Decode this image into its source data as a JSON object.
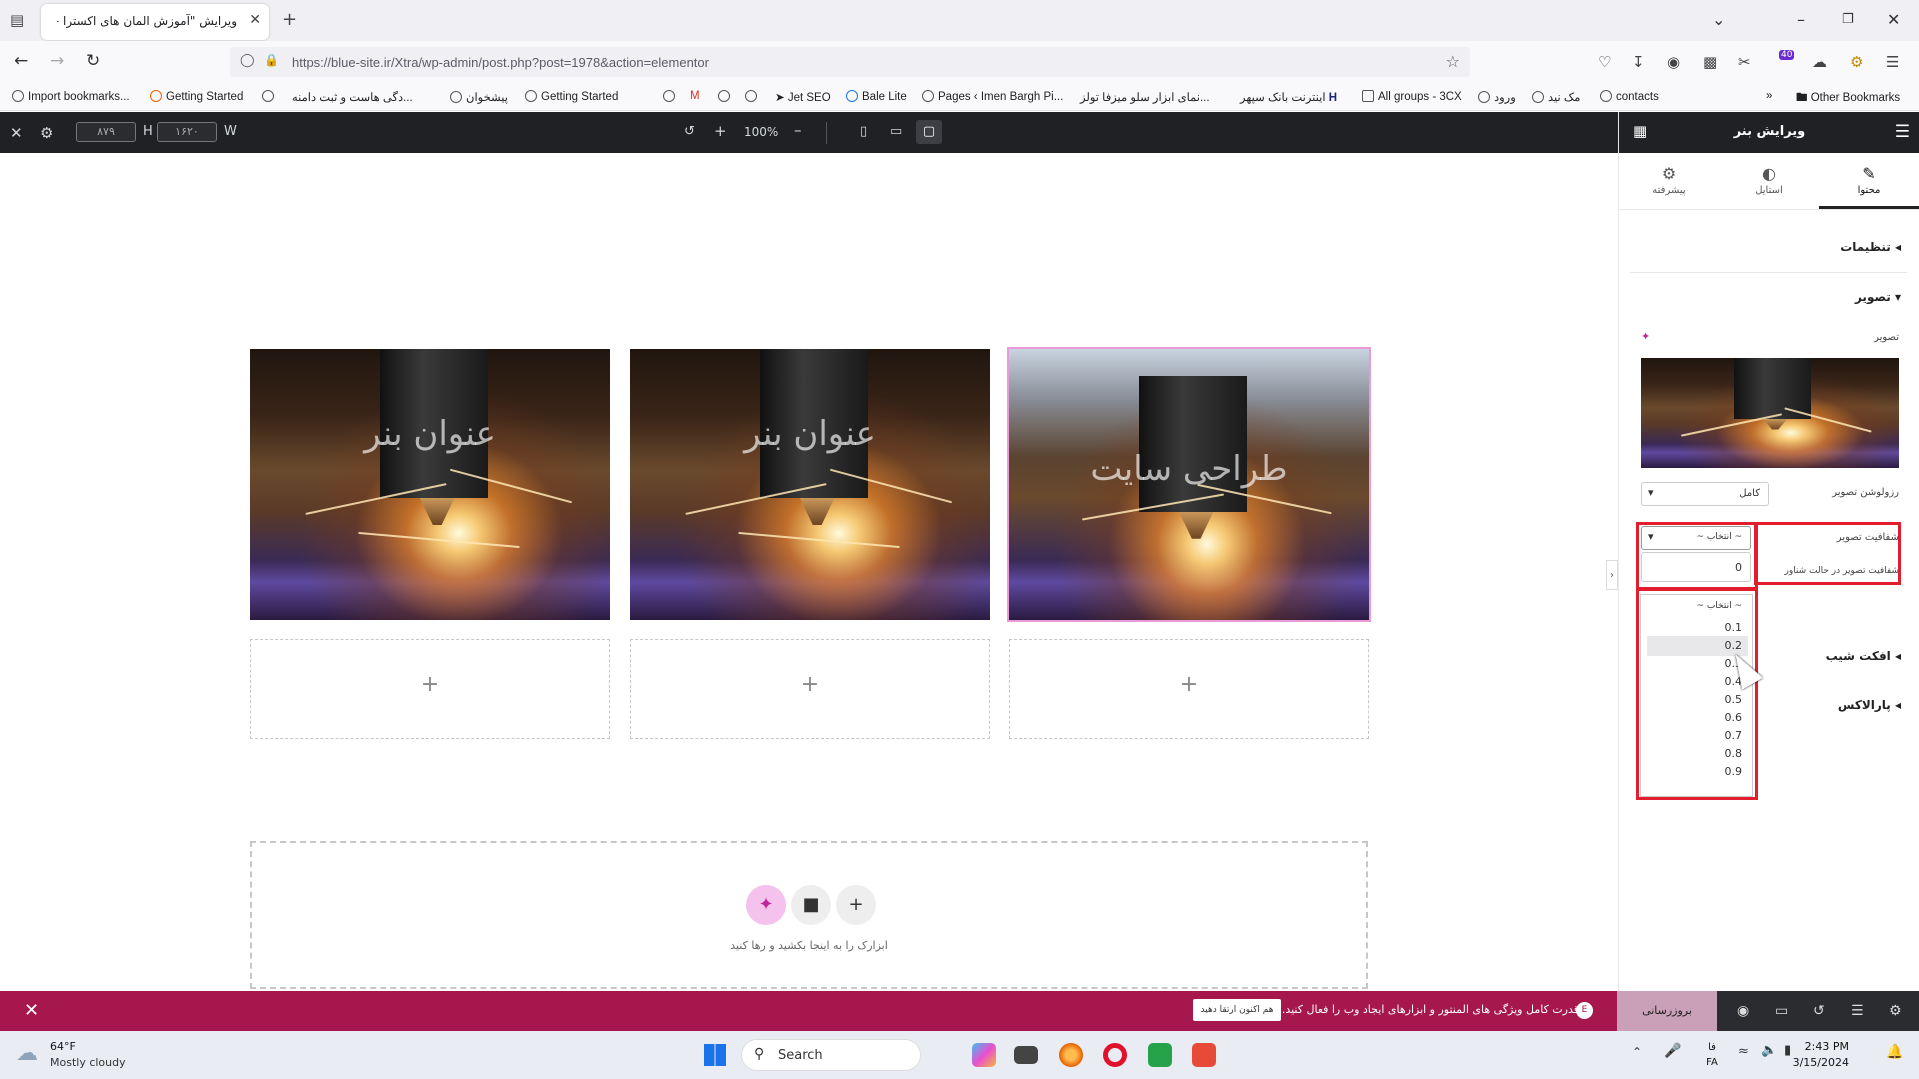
{
  "browser": {
    "tab_title": "ویرایش \"آموزش المان های اکسترا –",
    "url": "https://blue-site.ir/Xtra/wp-admin/post.php?post=1978&action=elementor",
    "badge_count": "40",
    "bookmarks": [
      "Import bookmarks...",
      "Getting Started",
      "...دگی هاست و ثبت دامنه",
      "پیشخوان",
      "Getting Started",
      "Jet SEO",
      "Bale Lite",
      "Pages ‹ Imen Bargh Pi...",
      "...نمای ابزار سلو میزفا تولز",
      "اینترنت بانک سپهر",
      "All groups - 3CX",
      "ورود",
      "مک نید",
      "contacts"
    ],
    "other_bookmarks": "Other Bookmarks"
  },
  "editor_top": {
    "height_value": "۸۷۹",
    "height_label": "H",
    "width_value": "۱۶۲۰",
    "width_label": "W",
    "zoom": "100%"
  },
  "canvas": {
    "images": [
      {
        "caption": "عنوان بنر"
      },
      {
        "caption": "عنوان بنر"
      },
      {
        "caption": "طراحی سایت"
      }
    ],
    "add_symbol": "+",
    "drop_text": "ابزارک را به اینجا بکشید و رها کنید"
  },
  "panel": {
    "title": "ویرایش بنر",
    "tabs": [
      "محتوا",
      "استایل",
      "پیشرفته"
    ],
    "sections": {
      "settings": "تنظیمات",
      "image": "تصویر",
      "gradient": "افکت شیب",
      "parallax": "پارالاکس"
    },
    "image_label": "تصویر",
    "resolution_label": "رزولوشن تصویر",
    "resolution_value": "کامل",
    "opacity_label": "شفافیت تصویر",
    "opacity_value": "~ انتخاب ~",
    "hover_opacity_label": "شفافیت تصویر در حالت شناور",
    "hover_value": "0",
    "dropdown": {
      "items": [
        "~ انتخاب ~",
        "0.1",
        "0.2",
        "0.3",
        "0.4",
        "0.5",
        "0.6",
        "0.7",
        "0.8",
        "0.9"
      ],
      "highlighted": "0.2"
    }
  },
  "footer": {
    "message": "قدرت کامل ویژگی های المنتور و ابزارهای ایجاد وب را فعال کنید.",
    "cta": "هم اکنون ارتقا دهید",
    "update_button": "بروزرسانی"
  },
  "taskbar": {
    "weather_temp": "64°F",
    "weather_desc": "Mostly cloudy",
    "search_placeholder": "Search",
    "lang_fa": "فا",
    "lang_code": "FA",
    "time": "2:43 PM",
    "date": "3/15/2024"
  },
  "colors": {
    "editor_dark": "#1f2124",
    "footer_bar": "#a5174d",
    "highlight_red": "#e11d2e",
    "selected_outline": "#e89bd6"
  }
}
